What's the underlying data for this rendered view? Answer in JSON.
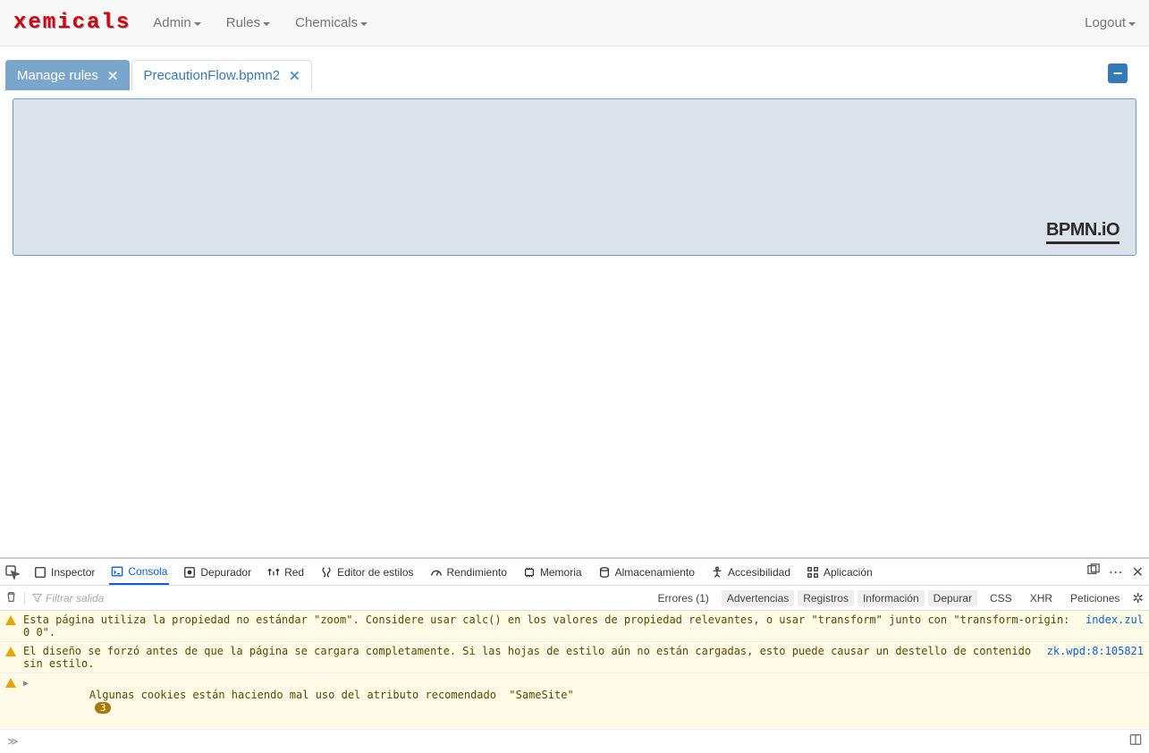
{
  "navbar": {
    "brand": "xemicals",
    "menu": [
      "Admin",
      "Rules",
      "Chemicals"
    ],
    "logout": "Logout"
  },
  "tabs": {
    "manage": "Manage rules",
    "file": "PrecautionFlow.bpmn2",
    "collapse": "−"
  },
  "canvas": {
    "logo": "BPMN.iO"
  },
  "devtools": {
    "tabs": {
      "inspector": "Inspector",
      "console": "Consola",
      "debugger": "Depurador",
      "network": "Red",
      "styles": "Editor de estilos",
      "perf": "Rendimiento",
      "memory": "Memoria",
      "storage": "Almacenamiento",
      "a11y": "Accesibilidad",
      "app": "Aplicación"
    },
    "filter_placeholder": "Filtrar salida",
    "filters": {
      "errors": "Errores (1)",
      "warnings": "Advertencias",
      "logs": "Registros",
      "info": "Información",
      "debug": "Depurar",
      "css": "CSS",
      "xhr": "XHR",
      "requests": "Peticiones"
    },
    "messages": [
      {
        "level": "warn",
        "text": "Esta página utiliza la propiedad no estándar \"zoom\". Considere usar calc() en los valores de propiedad relevantes, o usar \"transform\" junto con \"transform-origin: 0 0\".",
        "src": "index.zul"
      },
      {
        "level": "warn",
        "text": "El diseño se forzó antes de que la página se cargara completamente. Si las hojas de estilo aún no están cargadas, esto puede causar un destello de contenido sin estilo.",
        "src": "zk.wpd:8:105821"
      },
      {
        "level": "warn",
        "expandable": true,
        "text": "Algunas cookies están haciendo mal uso del atributo recomendado  \"SameSite\"",
        "count": "3"
      }
    ],
    "prompt": "≫"
  }
}
